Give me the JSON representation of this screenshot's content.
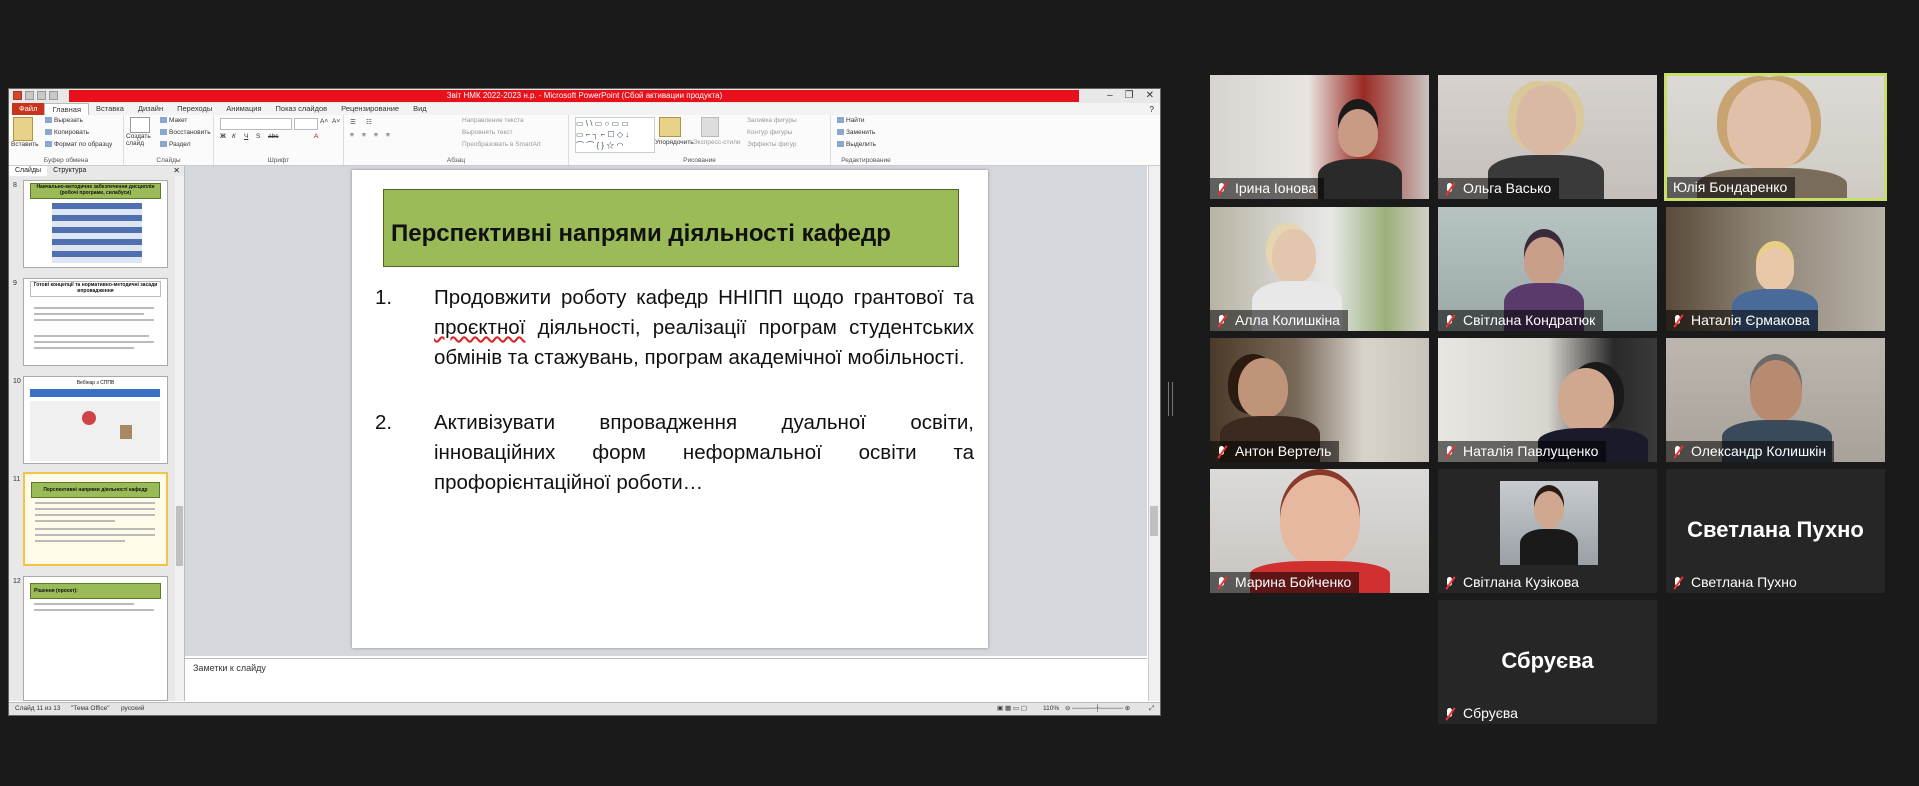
{
  "powerpoint": {
    "title": "Звіт НМК 2022-2023 н.р. - Microsoft PowerPoint (Сбой активации продукта)",
    "tabs": [
      "Файл",
      "Главная",
      "Вставка",
      "Дизайн",
      "Переходы",
      "Анимация",
      "Показ слайдов",
      "Рецензирование",
      "Вид"
    ],
    "ribbon": {
      "clipboard": {
        "label": "Буфер обмена",
        "paste": "Вставить",
        "cut": "Вырезать",
        "copy": "Копировать",
        "format_painter": "Формат по образцу"
      },
      "slides": {
        "label": "Слайды",
        "new_slide": "Создать слайд",
        "layout": "Макет",
        "reset": "Восстановить",
        "section": "Раздел"
      },
      "font": {
        "label": "Шрифт"
      },
      "paragraph": {
        "label": "Абзац",
        "text_direction": "Направление текста",
        "align_text": "Выровнять текст",
        "smartart": "Преобразовать в SmartArt"
      },
      "drawing": {
        "label": "Рисование",
        "arrange": "Упорядочить",
        "quick_styles": "Экспресс-стили",
        "shape_fill": "Заливка фигуры",
        "shape_outline": "Контур фигуры",
        "shape_effects": "Эффекты фигур"
      },
      "editing": {
        "label": "Редактирование",
        "find": "Найти",
        "replace": "Заменить",
        "select": "Выделить"
      }
    },
    "panel_tabs": [
      "Слайды",
      "Структура"
    ],
    "thumbnails": [
      {
        "num": "8",
        "title": "Навчально-методичне забезпечення дисциплін (робочі програми, силабуси)"
      },
      {
        "num": "9",
        "title": "Готові концепції та нормативно-методичні засади впровадження"
      },
      {
        "num": "10",
        "title": "Вебінар з СППВ"
      },
      {
        "num": "11",
        "title": "Перспективні напрями діяльності кафедр"
      },
      {
        "num": "12",
        "title": "Рішення (проєкт):"
      }
    ],
    "slide": {
      "title": "Перспективні напрями діяльності кафедр",
      "items": [
        {
          "num": "1.",
          "text_a": "Продовжити роботу кафедр ННІПП щодо грантової та ",
          "text_wavy": "проєктної",
          "text_b": " діяльності, реалізації програм студентських обмінів та стажувань, програм академічної мобільності."
        },
        {
          "num": "2.",
          "text_a": "Активізувати впровадження дуальної освіти, інноваційних форм неформальної освіти та профорієнтаційної роботи…",
          "text_wavy": "",
          "text_b": ""
        }
      ]
    },
    "notes_placeholder": "Заметки к слайду",
    "status": {
      "slide": "Слайд 11 из 13",
      "theme": "\"Тема Office\"",
      "language": "русский",
      "zoom": "110%"
    }
  },
  "participants": [
    {
      "name": "Ірина Іонова",
      "muted": true,
      "video": true,
      "speaking": false
    },
    {
      "name": "Ольга Васько",
      "muted": true,
      "video": true,
      "speaking": false
    },
    {
      "name": "Юлія Бондаренко",
      "muted": false,
      "video": true,
      "speaking": true
    },
    {
      "name": "Алла Колишкіна",
      "muted": true,
      "video": true,
      "speaking": false
    },
    {
      "name": "Світлана Кондратюк",
      "muted": true,
      "video": true,
      "speaking": false
    },
    {
      "name": "Наталія Єрмакова",
      "muted": true,
      "video": true,
      "speaking": false
    },
    {
      "name": "Антон Вертель",
      "muted": true,
      "video": true,
      "speaking": false
    },
    {
      "name": "Наталія Павлущенко",
      "muted": true,
      "video": true,
      "speaking": false
    },
    {
      "name": "Олександр Колишкін",
      "muted": true,
      "video": true,
      "speaking": false
    },
    {
      "name": "Марина Бойченко",
      "muted": true,
      "video": true,
      "speaking": false
    },
    {
      "name": "Світлана Кузікова",
      "muted": true,
      "video": false,
      "speaking": false
    },
    {
      "name": "Светлана Пухно",
      "muted": true,
      "video": false,
      "speaking": false,
      "display_text": "Светлана Пухно"
    },
    {
      "name": "Сбруєва",
      "muted": true,
      "video": false,
      "speaking": false,
      "display_text": "Сбруєва"
    }
  ],
  "colors": {
    "speaker_border": "#c8e06a",
    "slide_title_fill": "#9bbb59",
    "title_bar": "#e8101a"
  }
}
